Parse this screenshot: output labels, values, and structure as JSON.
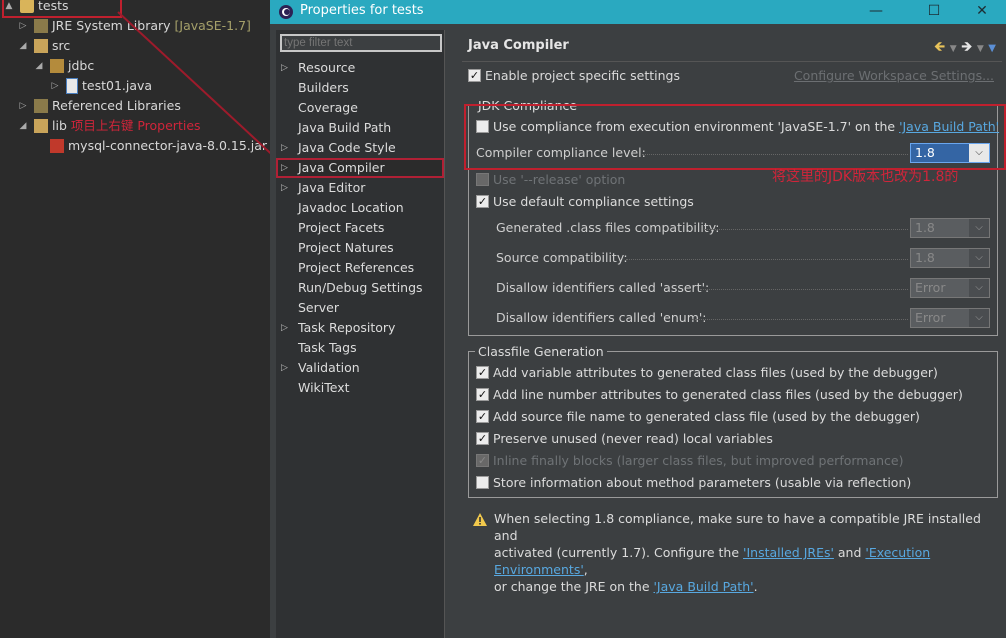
{
  "explorer": {
    "project": "tests",
    "jre_label": "JRE System Library",
    "jre_version": "[JavaSE-1.7]",
    "src": "src",
    "pkg": "jdbc",
    "file": "test01.java",
    "ref_libs": "Referenced Libraries",
    "lib": "lib",
    "lib_annotation": "项目上右键 Properties",
    "jar": "mysql-connector-java-8.0.15.jar"
  },
  "dialog": {
    "title": "Properties for tests",
    "min": "—",
    "max": "☐",
    "close": "✕",
    "filter_placeholder": "type filter text",
    "nav": [
      {
        "label": "Resource",
        "arrow": true
      },
      {
        "label": "Builders",
        "arrow": false
      },
      {
        "label": "Coverage",
        "arrow": false
      },
      {
        "label": "Java Build Path",
        "arrow": false
      },
      {
        "label": "Java Code Style",
        "arrow": true
      },
      {
        "label": "Java Compiler",
        "arrow": true,
        "selected": true
      },
      {
        "label": "Java Editor",
        "arrow": true
      },
      {
        "label": "Javadoc Location",
        "arrow": false
      },
      {
        "label": "Project Facets",
        "arrow": false
      },
      {
        "label": "Project Natures",
        "arrow": false
      },
      {
        "label": "Project References",
        "arrow": false
      },
      {
        "label": "Run/Debug Settings",
        "arrow": false
      },
      {
        "label": "Server",
        "arrow": false
      },
      {
        "label": "Task Repository",
        "arrow": true
      },
      {
        "label": "Task Tags",
        "arrow": false
      },
      {
        "label": "Validation",
        "arrow": true
      },
      {
        "label": "WikiText",
        "arrow": false
      }
    ],
    "page_title": "Java Compiler",
    "enable_specific": "Enable project specific settings",
    "configure_ws": "Configure Workspace Settings...",
    "jdk_group": "JDK Compliance",
    "use_env_prefix": "Use compliance from execution environment 'JavaSE-1.7' on the ",
    "java_build_path_link": "'Java Build Path'",
    "compliance_level_label": "Compiler compliance level:",
    "compliance_level_value": "1.8",
    "annotation_cn": "将这里的JDK版本也改为1.8的",
    "release_option": "Use '--release' option",
    "use_default": "Use default compliance settings",
    "generated_label": "Generated .class files compatibility:",
    "generated_value": "1.8",
    "source_label": "Source compatibility:",
    "source_value": "1.8",
    "assert_label": "Disallow identifiers called 'assert':",
    "assert_value": "Error",
    "enum_label": "Disallow identifiers called 'enum':",
    "enum_value": "Error",
    "classfile_group": "Classfile Generation",
    "cf_variable": "Add variable attributes to generated class files (used by the debugger)",
    "cf_line": "Add line number attributes to generated class files (used by the debugger)",
    "cf_source": "Add source file name to generated class file (used by the debugger)",
    "cf_preserve": "Preserve unused (never read) local variables",
    "cf_inline": "Inline finally blocks (larger class files, but improved performance)",
    "cf_store": "Store information about method parameters (usable via reflection)",
    "note_line1": "When selecting 1.8 compliance, make sure to have a compatible JRE installed and",
    "note_line2_a": "activated (currently 1.7). Configure the ",
    "note_installed_jres": "'Installed JREs'",
    "note_and": " and ",
    "note_exec_envs": "'Execution Environments'",
    "note_line2_c": ",",
    "note_line3_a": "or change the JRE on the ",
    "note_jbp": "'Java Build Path'",
    "note_line3_c": "."
  },
  "colors": {
    "annotation_red": "#c0202e",
    "titlebar": "#2aa9c0",
    "link": "#58a8e0"
  }
}
